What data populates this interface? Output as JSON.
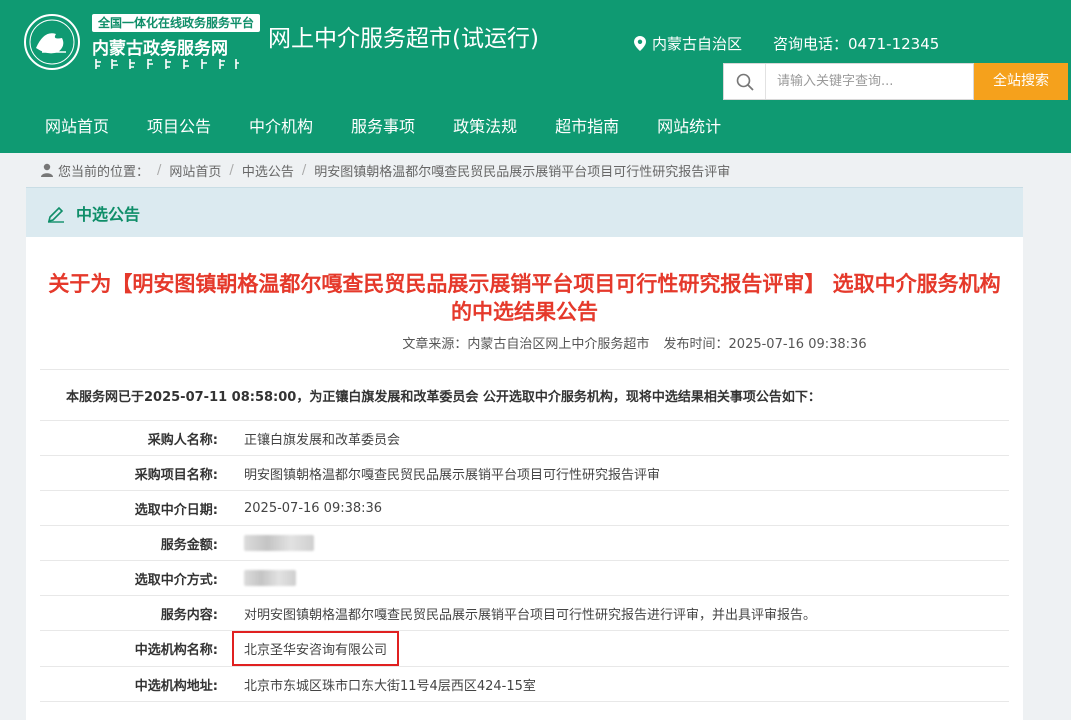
{
  "header": {
    "badge": "全国一体化在线政务服务平台",
    "portal_name": "内蒙古政务服务网",
    "site_title": "网上中介服务超市(试运行)",
    "region": "内蒙古自治区",
    "hotline": "咨询电话：0471-12345",
    "search_placeholder": "请输入关键字查询...",
    "search_button": "全站搜索"
  },
  "nav": [
    "网站首页",
    "项目公告",
    "中介机构",
    "服务事项",
    "政策法规",
    "超市指南",
    "网站统计"
  ],
  "breadcrumb": {
    "prefix": "您当前的位置：",
    "items": [
      "网站首页",
      "中选公告",
      "明安图镇朝格温都尔嘎查民贸民品展示展销平台项目可行性研究报告评审"
    ]
  },
  "panel": {
    "heading": "中选公告",
    "title": "关于为【明安图镇朝格温都尔嘎查民贸民品展示展销平台项目可行性研究报告评审】 选取中介服务机构的中选结果公告",
    "source": "文章来源：内蒙古自治区网上中介服务超市",
    "published": "发布时间：2025-07-16 09:38:36",
    "intro": "本服务网已于2025-07-11 08:58:00，为正镶白旗发展和改革委员会 公开选取中介服务机构，现将中选结果相关事项公告如下：",
    "rows": [
      {
        "label": "采购人名称:",
        "value": "正镶白旗发展和改革委员会"
      },
      {
        "label": "采购项目名称:",
        "value": "明安图镇朝格温都尔嘎查民贸民品展示展销平台项目可行性研究报告评审"
      },
      {
        "label": "选取中介日期:",
        "value": "2025-07-16 09:38:36"
      },
      {
        "label": "服务金额:",
        "value": ""
      },
      {
        "label": "选取中介方式:",
        "value": ""
      },
      {
        "label": "服务内容:",
        "value": "对明安图镇朝格温都尔嘎查民贸民品展示展销平台项目可行性研究报告进行评审，并出具评审报告。"
      },
      {
        "label": "中选机构名称:",
        "value": "北京圣华安咨询有限公司"
      },
      {
        "label": "中选机构地址:",
        "value": "北京市东城区珠市口东大街11号4层西区424-15室"
      }
    ]
  },
  "colors": {
    "brand": "#0f9a72",
    "search_button": "#f5a11c",
    "title_red": "#e5392b",
    "highlight_border": "#e02020"
  },
  "icons": [
    "emblem-logo-icon",
    "location-pin-icon",
    "search-icon",
    "user-icon",
    "edit-icon"
  ]
}
